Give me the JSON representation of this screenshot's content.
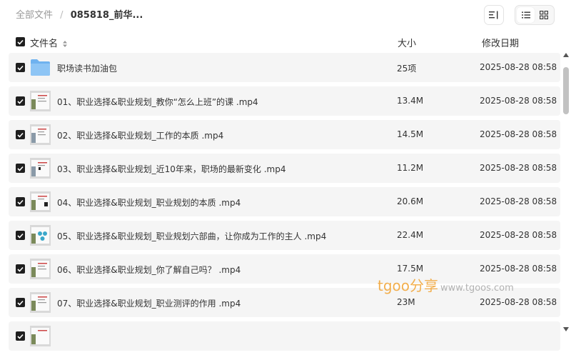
{
  "breadcrumb": {
    "root": "全部文件",
    "separator": "/",
    "current": "085818_前华..."
  },
  "table_header": {
    "name": "文件名",
    "size": "大小",
    "date": "修改日期"
  },
  "rows": [
    {
      "type": "folder",
      "name": "职场读书加油包",
      "size": "25项",
      "date": "2025-08-28 08:58"
    },
    {
      "type": "video",
      "name": "01、职业选择&职业规划_教你“怎么上班”的课 .mp4",
      "size": "13.4M",
      "date": "2025-08-28 08:58"
    },
    {
      "type": "video",
      "name": "02、职业选择&职业规划_工作的本质 .mp4",
      "size": "14.5M",
      "date": "2025-08-28 08:58"
    },
    {
      "type": "video",
      "name": "03、职业选择&职业规划_近10年来，职场的最新变化 .mp4",
      "size": "11.2M",
      "date": "2025-08-28 08:58"
    },
    {
      "type": "video",
      "name": "04、职业选择&职业规划_职业规划的本质 .mp4",
      "size": "20.6M",
      "date": "2025-08-28 08:58"
    },
    {
      "type": "video",
      "name": "05、职业选择&职业规划_职业规划六部曲，让你成为工作的主人 .mp4",
      "size": "22.4M",
      "date": "2025-08-28 08:58"
    },
    {
      "type": "video",
      "name": "06、职业选择&职业规划_你了解自己吗？ .mp4",
      "size": "17.5M",
      "date": "2025-08-28 08:58"
    },
    {
      "type": "video",
      "name": "07、职业选择&职业规划_职业测评的作用 .mp4",
      "size": "23M",
      "date": "2025-08-28 08:58"
    },
    {
      "type": "video",
      "name": "",
      "size": "",
      "date": ""
    }
  ],
  "watermark": {
    "brand": "tgoo",
    "share": "分享",
    "url": "www.tgoos.com"
  },
  "colors": {
    "row_bg": "#f5f5f5",
    "checkbox": "#1f1f1f",
    "folder": "#6fb2ef",
    "watermark": "#f2a73b"
  }
}
